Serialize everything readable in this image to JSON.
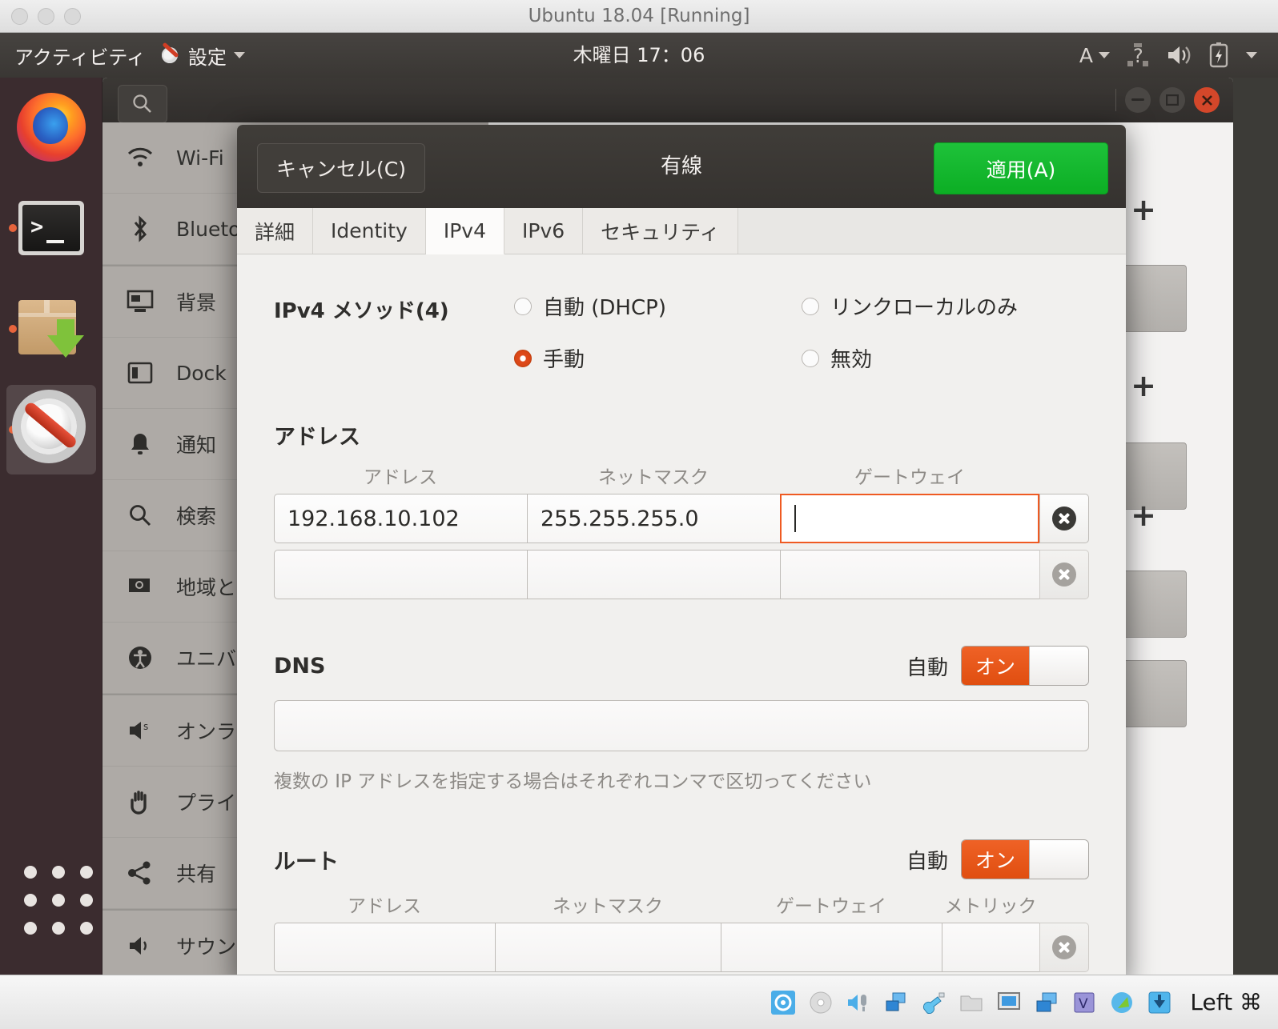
{
  "vbox": {
    "title": "Ubuntu 18.04 [Running]",
    "status_key": "Left ⌘",
    "status_icons": [
      "hard-disk-icon",
      "optical-disk-icon",
      "audio-icon",
      "network-icon",
      "usb-icon",
      "shared-folder-icon",
      "display-icon",
      "recording-icon",
      "virtualization-icon",
      "mouse-integration-icon",
      "host-key-icon"
    ]
  },
  "top_panel": {
    "activities": "アクティビティ",
    "app_name": "設定",
    "clock": "木曜日 17：06",
    "ime": "A",
    "icons": [
      "settings-app-icon",
      "caret-down-icon",
      "network-icon",
      "volume-icon",
      "battery-icon",
      "caret-down-icon"
    ]
  },
  "dock": {
    "items": [
      {
        "name": "firefox",
        "running": false
      },
      {
        "name": "terminal",
        "running": true
      },
      {
        "name": "software",
        "running": true
      },
      {
        "name": "settings",
        "running": true,
        "active": true
      }
    ],
    "app_grid": "show-applications"
  },
  "settings_window": {
    "search_icon": "search-icon",
    "window_controls": [
      "minimize-icon",
      "maximize-icon",
      "close-icon"
    ],
    "sidebar": [
      {
        "label": "Wi-Fi",
        "icon": "wifi-icon"
      },
      {
        "label": "Bluetooth",
        "icon": "bluetooth-icon"
      },
      {
        "label": "背景",
        "icon": "background-icon"
      },
      {
        "label": "Dock",
        "icon": "dock-icon"
      },
      {
        "label": "通知",
        "icon": "bell-icon"
      },
      {
        "label": "検索",
        "icon": "search-icon"
      },
      {
        "label": "地域と言語",
        "icon": "region-icon"
      },
      {
        "label": "ユニバーサルアクセス",
        "icon": "accessibility-icon"
      },
      {
        "label": "オンラインアカウント",
        "icon": "online-accounts-icon"
      },
      {
        "label": "プライバシー",
        "icon": "privacy-icon"
      },
      {
        "label": "共有",
        "icon": "share-icon"
      },
      {
        "label": "サウンド",
        "icon": "sound-icon"
      }
    ],
    "content": {
      "add_button": "+"
    }
  },
  "dialog": {
    "title": "有線",
    "cancel_label": "キャンセル(C)",
    "apply_label": "適用(A)",
    "tabs": [
      {
        "label": "詳細",
        "active": false
      },
      {
        "label": "Identity",
        "active": false
      },
      {
        "label": "IPv4",
        "active": true
      },
      {
        "label": "IPv6",
        "active": false
      },
      {
        "label": "セキュリティ",
        "active": false
      }
    ],
    "ipv4": {
      "method_label": "IPv4 メソッド(4)",
      "methods": [
        {
          "label": "自動 (DHCP)",
          "checked": false
        },
        {
          "label": "リンクローカルのみ",
          "checked": false
        },
        {
          "label": "手動",
          "checked": true
        },
        {
          "label": "無効",
          "checked": false
        }
      ],
      "addresses": {
        "title": "アドレス",
        "columns": [
          "アドレス",
          "ネットマスク",
          "ゲートウェイ"
        ],
        "rows": [
          {
            "address": "192.168.10.102",
            "netmask": "255.255.255.0",
            "gateway": "",
            "focused_column": 2,
            "delete_enabled": true
          },
          {
            "address": "",
            "netmask": "",
            "gateway": "",
            "focused_column": -1,
            "delete_enabled": false
          }
        ]
      },
      "dns": {
        "title": "DNS",
        "auto_label": "自動",
        "toggle_state": "オン",
        "value": "",
        "hint": "複数の IP アドレスを指定する場合はそれぞれコンマで区切ってください"
      },
      "routes": {
        "title": "ルート",
        "auto_label": "自動",
        "toggle_state": "オン",
        "columns": [
          "アドレス",
          "ネットマスク",
          "ゲートウェイ",
          "メトリック"
        ],
        "rows": [
          {
            "address": "",
            "netmask": "",
            "gateway": "",
            "metric": "",
            "delete_enabled": false
          }
        ]
      }
    }
  },
  "colors": {
    "ubuntu_orange": "#e04e10",
    "apply_green": "#14b82c",
    "focus_orange": "#ef5a22",
    "panel_dark": "#3a3734"
  }
}
